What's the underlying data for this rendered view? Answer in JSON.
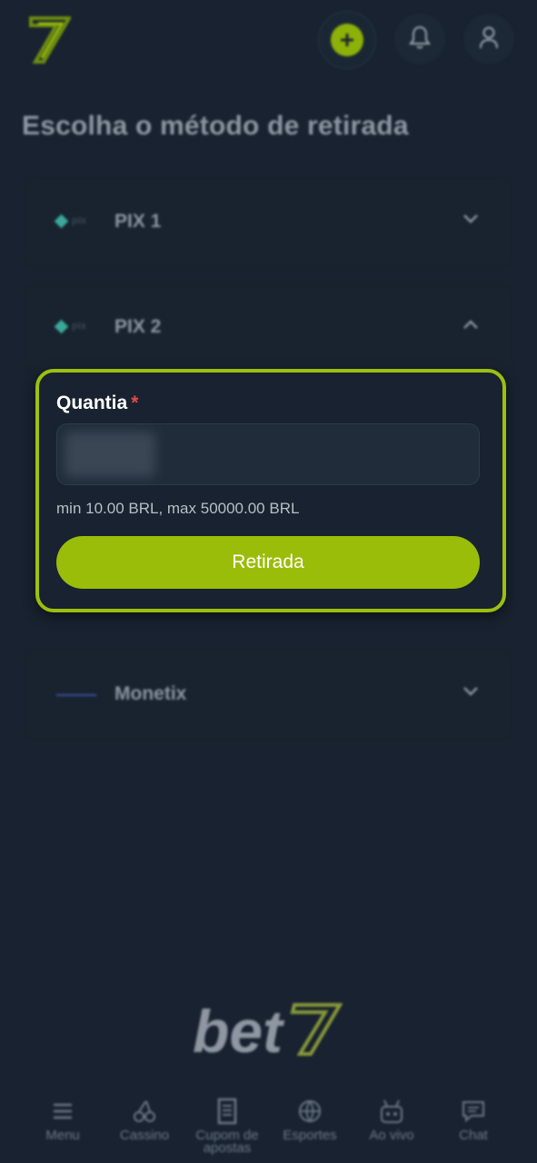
{
  "page": {
    "title": "Escolha o método de retirada"
  },
  "colors": {
    "background": "#182230",
    "accent": "#9abd0a",
    "required": "#e5484d"
  },
  "methods": [
    {
      "label": "PIX 1",
      "expanded": false,
      "icon": "pix-logo-icon"
    },
    {
      "label": "PIX 2",
      "expanded": true,
      "icon": "pix-logo-icon"
    },
    {
      "label": "Monetix",
      "expanded": false,
      "icon": "monetix-logo-icon"
    }
  ],
  "form": {
    "amount_label": "Quantia",
    "required_mark": "*",
    "limits_text": "min 10.00 BRL, max 50000.00 BRL",
    "submit_label": "Retirada"
  },
  "nav": [
    {
      "label": "Menu",
      "icon": "menu-icon"
    },
    {
      "label": "Cassino",
      "icon": "cherries-icon"
    },
    {
      "label": "Cupom de apostas",
      "icon": "receipt-icon"
    },
    {
      "label": "Esportes",
      "icon": "ball-icon"
    },
    {
      "label": "Ao vivo",
      "icon": "live-icon"
    },
    {
      "label": "Chat",
      "icon": "chat-icon"
    }
  ]
}
